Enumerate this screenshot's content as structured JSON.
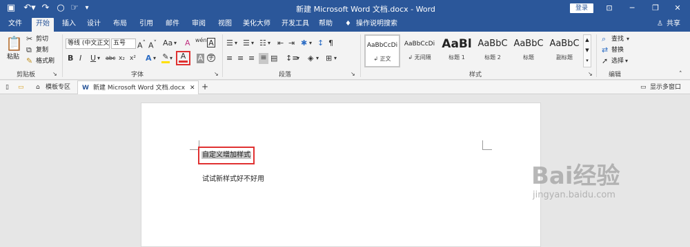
{
  "window": {
    "title": "新建 Microsoft Word 文档.docx - Word",
    "login_label": "登录",
    "share_label": "共享"
  },
  "menu": {
    "file": "文件",
    "home": "开始",
    "insert": "插入",
    "design": "设计",
    "layout": "布局",
    "references": "引用",
    "mailings": "邮件",
    "review": "审阅",
    "view": "视图",
    "beautify": "美化大师",
    "developer": "开发工具",
    "help": "帮助",
    "tell_me": "操作说明搜索"
  },
  "clipboard": {
    "paste": "粘贴",
    "cut": "剪切",
    "copy": "复制",
    "format_painter": "格式刷",
    "group": "剪贴板"
  },
  "font": {
    "name": "等线 (中文正文)",
    "size": "五号",
    "group": "字体",
    "bold": "B",
    "italic": "I",
    "underline": "U",
    "strike": "abc",
    "sub": "x₂",
    "sup": "x²",
    "aa": "Aa"
  },
  "paragraph": {
    "group": "段落"
  },
  "styles": {
    "group": "样式",
    "items": [
      {
        "preview": "AaBbCcDi",
        "name": "↲ 正文"
      },
      {
        "preview": "AaBbCcDi",
        "name": "↲ 无间隔"
      },
      {
        "preview": "AaBl",
        "name": "标题 1"
      },
      {
        "preview": "AaBbC",
        "name": "标题 2"
      },
      {
        "preview": "AaBbC",
        "name": "标题"
      },
      {
        "preview": "AaBbC",
        "name": "副标题"
      }
    ]
  },
  "editing": {
    "find": "查找",
    "replace": "替换",
    "select": "选择",
    "group": "编辑"
  },
  "tabs": {
    "templates": "模板专区",
    "doc": "新建 Microsoft Word 文档.docx",
    "multi_window": "显示多窗口"
  },
  "document": {
    "line1": "自定义增加样式",
    "line2": "试试新样式好不好用"
  },
  "watermark": {
    "brand": "Bai经验",
    "url": "jingyan.baidu.com"
  },
  "colors": {
    "brand": "#2b579a",
    "highlight_box": "#e03030"
  }
}
